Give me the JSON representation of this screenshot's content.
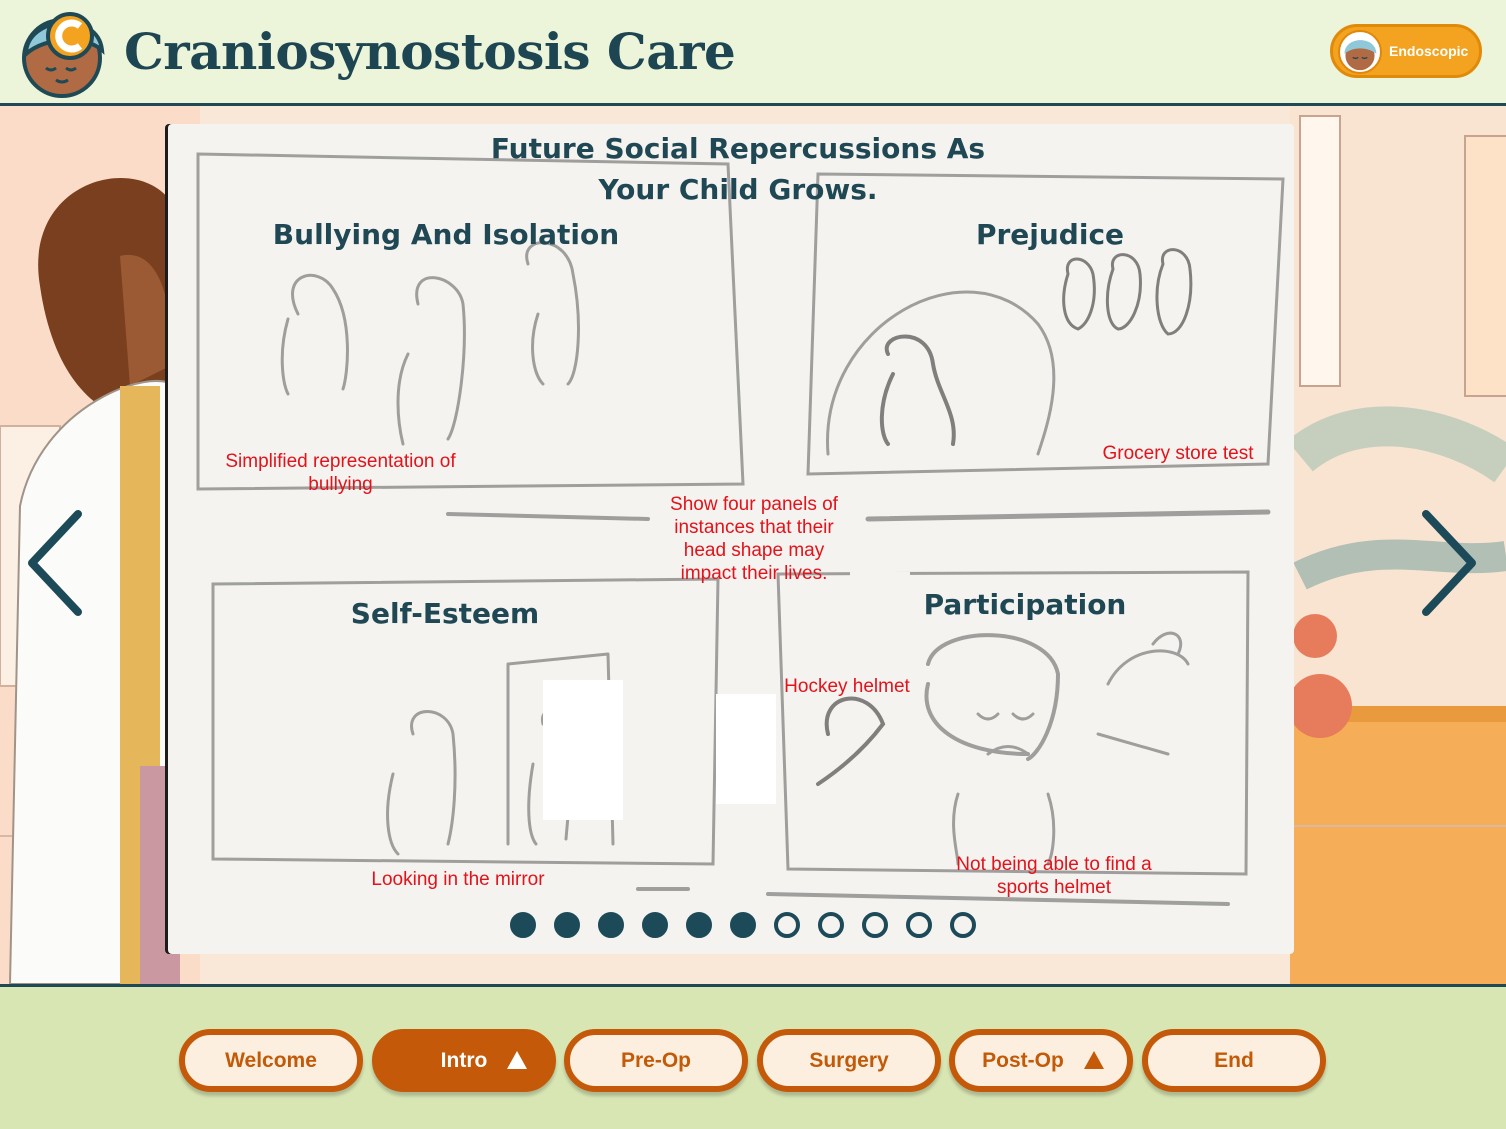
{
  "header": {
    "title": "Craniosynostosis Care",
    "mode_label": "Endoscopic"
  },
  "slide": {
    "title_line1": "Future Social Repercussions As",
    "title_line2": "Your Child Grows.",
    "panels": [
      {
        "heading": "Bullying And Isolation",
        "note": "Simplified representation of bullying"
      },
      {
        "heading": "Prejudice",
        "note": "Grocery store test"
      },
      {
        "heading": "Self-Esteem",
        "note": "Looking in the mirror"
      },
      {
        "heading": "Participation",
        "note": "Not being able to find a sports helmet",
        "extra_note": "Hockey helmet"
      }
    ],
    "center_note": "Show four panels of instances that their head shape may impact their lives.",
    "progress": {
      "total": 11,
      "current": 6
    }
  },
  "nav": {
    "prev_icon": "chevron-left-icon",
    "next_icon": "chevron-right-icon",
    "tabs": [
      {
        "label": "Welcome",
        "active": false,
        "has_menu": false
      },
      {
        "label": "Intro",
        "active": true,
        "has_menu": true
      },
      {
        "label": "Pre-Op",
        "active": false,
        "has_menu": false
      },
      {
        "label": "Surgery",
        "active": false,
        "has_menu": false
      },
      {
        "label": "Post-Op",
        "active": false,
        "has_menu": true
      },
      {
        "label": "End",
        "active": false,
        "has_menu": false
      }
    ]
  },
  "colors": {
    "brand_dark": "#1f4754",
    "accent_orange": "#c45a09",
    "note_red": "#e3121b",
    "header_bg": "#ecf4da",
    "footer_bg": "#d8e6b4"
  }
}
